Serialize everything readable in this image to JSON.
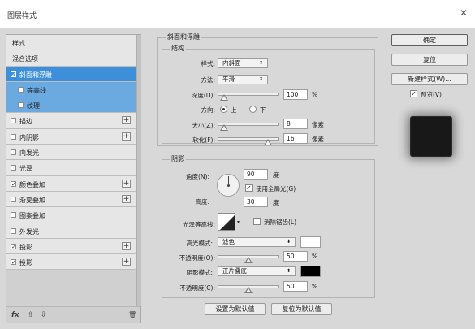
{
  "window": {
    "title": "图层样式"
  },
  "sidebar": {
    "items": [
      {
        "label": "样式",
        "check": false,
        "plus": false,
        "state": "plain"
      },
      {
        "label": "混合选项",
        "check": false,
        "plus": false,
        "state": "plain"
      },
      {
        "label": "斜面和浮雕",
        "check": true,
        "plus": false,
        "state": "active"
      },
      {
        "label": "等高线",
        "check": false,
        "plus": false,
        "state": "sub"
      },
      {
        "label": "纹理",
        "check": false,
        "plus": false,
        "state": "sub"
      },
      {
        "label": "描边",
        "check": false,
        "plus": true,
        "state": "normal"
      },
      {
        "label": "内阴影",
        "check": false,
        "plus": true,
        "state": "normal"
      },
      {
        "label": "内发光",
        "check": false,
        "plus": false,
        "state": "normal"
      },
      {
        "label": "光泽",
        "check": false,
        "plus": false,
        "state": "normal"
      },
      {
        "label": "颜色叠加",
        "check": true,
        "plus": true,
        "state": "normal"
      },
      {
        "label": "渐变叠加",
        "check": false,
        "plus": true,
        "state": "normal"
      },
      {
        "label": "图案叠加",
        "check": false,
        "plus": false,
        "state": "normal"
      },
      {
        "label": "外发光",
        "check": false,
        "plus": false,
        "state": "normal"
      },
      {
        "label": "投影",
        "check": true,
        "plus": true,
        "state": "normal"
      },
      {
        "label": "投影",
        "check": true,
        "plus": true,
        "state": "normal"
      }
    ],
    "footer": {
      "fx": "fx",
      "up": "⇧",
      "down": "⇩",
      "trash": "🗑"
    }
  },
  "bevel": {
    "section_title": "斜面和浮雕",
    "structure_title": "结构",
    "style_label": "样式:",
    "style_value": "内斜面",
    "method_label": "方法:",
    "method_value": "平滑",
    "depth_label": "深度(D):",
    "depth_value": "100",
    "depth_unit": "%",
    "direction_label": "方向:",
    "direction_up": "上",
    "direction_down": "下",
    "size_label": "大小(Z):",
    "size_value": "8",
    "size_unit": "像素",
    "soften_label": "软化(F):",
    "soften_value": "16",
    "soften_unit": "像素"
  },
  "shading": {
    "title": "阴影",
    "angle_label": "角度(N):",
    "angle_value": "90",
    "angle_unit": "度",
    "global_light_label": "使用全局光(G)",
    "altitude_label": "高度:",
    "altitude_value": "30",
    "altitude_unit": "度",
    "gloss_label": "光泽等高线:",
    "antialias_label": "消除锯齿(L)",
    "highlight_mode_label": "高光模式:",
    "highlight_mode_value": "滤色",
    "highlight_color": "#ffffff",
    "highlight_opacity_label": "不透明度(O):",
    "highlight_opacity_value": "50",
    "highlight_opacity_unit": "%",
    "shadow_mode_label": "阴影模式:",
    "shadow_mode_value": "正片叠底",
    "shadow_color": "#000000",
    "shadow_opacity_label": "不透明度(C):",
    "shadow_opacity_value": "50",
    "shadow_opacity_unit": "%"
  },
  "slider_levels": {
    "depth": 0.05,
    "size": 0.05,
    "soften": 0.88,
    "highlight_opacity": 0.5,
    "shadow_opacity": 0.5
  },
  "bottom": {
    "set_default": "设置为默认值",
    "reset_default": "复位为默认值"
  },
  "right": {
    "ok": "确定",
    "reset": "复位",
    "new_style": "新建样式(W)...",
    "preview_label": "预览(V)"
  }
}
